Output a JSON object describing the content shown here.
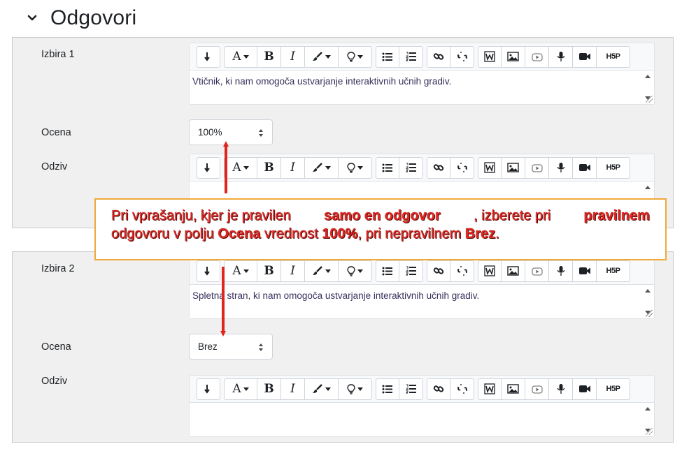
{
  "section": {
    "title": "Odgovori",
    "icon": "chevron-down-icon"
  },
  "choices": [
    {
      "label": "Izbira 1",
      "answer_text": "Vtičnik, ki nam omogoča ustvarjanje interaktivnih učnih gradiv.",
      "grade_label": "Ocena",
      "grade_value": "100%",
      "feedback_label": "Odziv",
      "feedback_text": ""
    },
    {
      "label": "Izbira 2",
      "answer_text": "Spletna stran, ki nam omogoča ustvarjanje interaktivnih učnih gradiv.",
      "grade_label": "Ocena",
      "grade_value": "Brez",
      "feedback_label": "Odziv",
      "feedback_text": ""
    }
  ],
  "toolbar": {
    "font_letter": "A",
    "bold_letter": "B",
    "italic_letter": "I",
    "h5p_label": "H5P",
    "icons": [
      "show-more-icon",
      "font-color-icon",
      "bold-icon",
      "italic-icon",
      "paint-brush-icon",
      "lightbulb-icon",
      "unordered-list-icon",
      "ordered-list-icon",
      "link-icon",
      "unlink-icon",
      "word-paste-icon",
      "image-icon",
      "media-icon",
      "microphone-icon",
      "video-camera-icon",
      "h5p-icon"
    ]
  },
  "annotation": {
    "line1_parts": [
      "Pri vprašanju, kjer je pravilen ",
      "samo en odgovor",
      ", izberete pri ",
      "pravilnem"
    ],
    "line2_parts": [
      "odgovoru v polju ",
      "Ocena",
      " vrednost ",
      "100%",
      ", pri nepravilnem ",
      "Brez",
      "."
    ],
    "text_color": "#e0251f",
    "border_color": "#f0a83a",
    "arrow_color": "#e0251f"
  }
}
